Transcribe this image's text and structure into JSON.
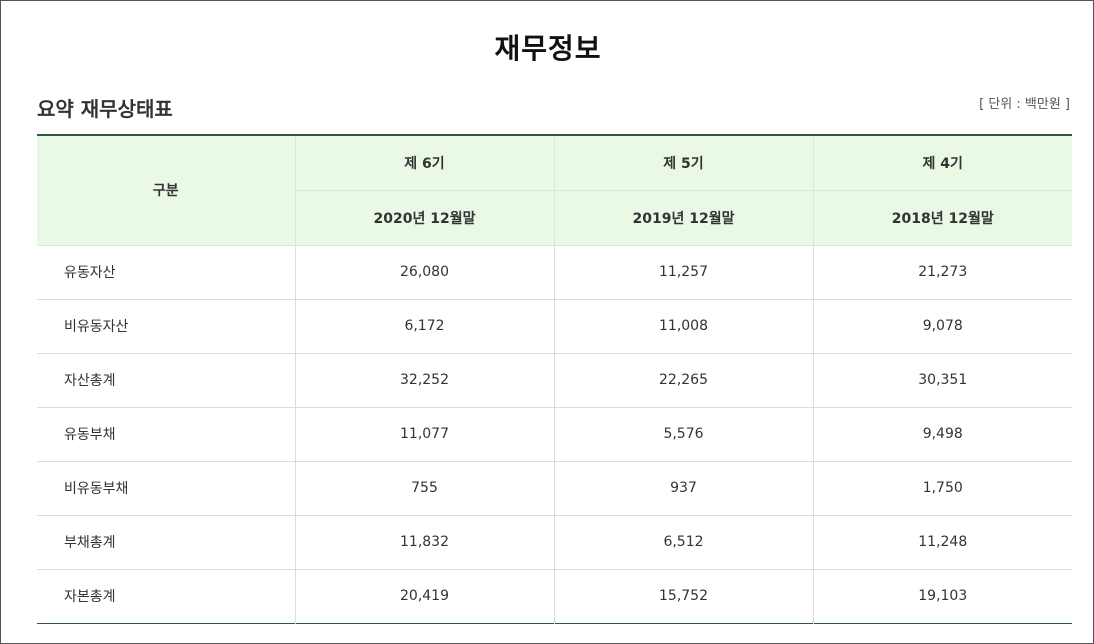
{
  "page": {
    "title": "재무정보"
  },
  "section": {
    "title": "요약 재무상태표",
    "unit": "[ 단위 : 백만원 ]"
  },
  "table": {
    "corner_label": "구분",
    "periods": [
      {
        "term": "제 6기",
        "date": "2020년 12월말"
      },
      {
        "term": "제 5기",
        "date": "2019년 12월말"
      },
      {
        "term": "제 4기",
        "date": "2018년 12월말"
      }
    ],
    "rows": [
      {
        "label": "유동자산",
        "values": [
          "26,080",
          "11,257",
          "21,273"
        ]
      },
      {
        "label": "비유동자산",
        "values": [
          "6,172",
          "11,008",
          "9,078"
        ]
      },
      {
        "label": "자산총계",
        "values": [
          "32,252",
          "22,265",
          "30,351"
        ]
      },
      {
        "label": "유동부채",
        "values": [
          "11,077",
          "5,576",
          "9,498"
        ]
      },
      {
        "label": "비유동부채",
        "values": [
          "755",
          "937",
          "1,750"
        ]
      },
      {
        "label": "부채총계",
        "values": [
          "11,832",
          "6,512",
          "11,248"
        ]
      },
      {
        "label": "자본총계",
        "values": [
          "20,419",
          "15,752",
          "19,103"
        ]
      }
    ]
  }
}
